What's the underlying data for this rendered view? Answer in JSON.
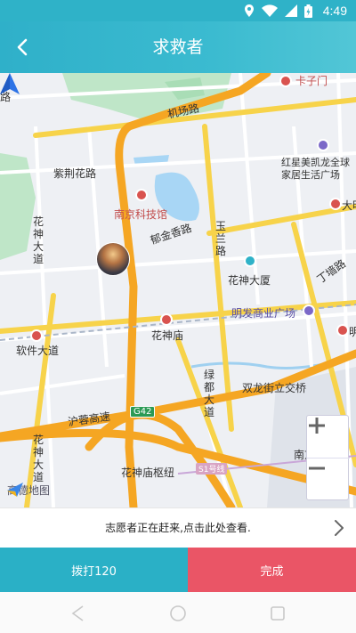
{
  "status_bar": {
    "time": "4:49",
    "icons": [
      "location-icon",
      "wifi-icon",
      "signal-icon",
      "battery-icon"
    ]
  },
  "app_bar": {
    "title": "求救者",
    "back_icon": "back-arrow-icon"
  },
  "map": {
    "labels": {
      "kazimen": "卡子门",
      "jichang_road": "机场路",
      "zijinghua_road": "紫荆花路",
      "hongxing": "红星美凯龙全球\n家居生活广场",
      "nanjing_science_museum": "南京科技馆",
      "yujinxiang_road": "郁金香路",
      "huashen_avenue_left": "花神大道",
      "yu_road": "玉兰路",
      "dachang": "大明",
      "huashen_building": "花神大厦",
      "dingqiang_road": "丁墙路",
      "mingfa_plaza": "明发商业广场",
      "ruanjian_avenue": "软件大道",
      "huashen_temple": "花神庙",
      "lvdu_avenue": "绿都大道",
      "shuanglong_interchange": "双龙街立交桥",
      "hurong_expressway": "沪蓉高速",
      "huashen_avenue_bottom": "花神大道",
      "huashen_hub": "花神庙枢纽",
      "nanjing_south_station": "南京南站",
      "partial_left": "路",
      "partial_right": "明"
    },
    "shields": {
      "g42": "G42"
    },
    "metro": {
      "line1": "S1号线"
    },
    "attribution": "高德地图",
    "zoom_in": "+",
    "zoom_out": "−"
  },
  "notice": {
    "text": "志愿者正在赶来,点击此处查看."
  },
  "actions": {
    "call_label": "拨打120",
    "done_label": "完成"
  },
  "colors": {
    "header": "#2fb2c8",
    "call_button": "#2ab0c6",
    "done_button": "#ea5566",
    "expressway": "#f5a623",
    "arterial": "#f7d34a"
  }
}
